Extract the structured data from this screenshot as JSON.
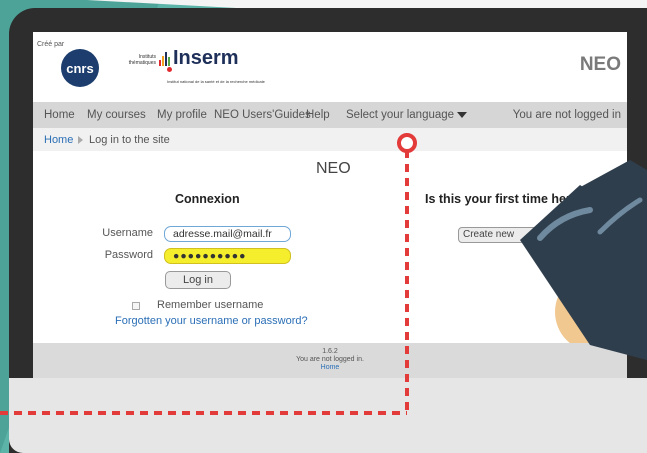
{
  "header": {
    "created_by": "Créé par",
    "cnrs_logo": "cnrs",
    "instituts_text": "Instituts thématiques",
    "inserm_logo": "Inserm",
    "inserm_subtitle": "Institut national de la santé et de la recherche médicale",
    "site_name": "NEO"
  },
  "nav": {
    "items": [
      "Home",
      "My courses",
      "My profile",
      "NEO Users'Guides",
      "Help",
      "Select your language"
    ],
    "login_status": "You are not logged in"
  },
  "breadcrumb": {
    "home": "Home",
    "current": "Log in to the site"
  },
  "main": {
    "title": "NEO",
    "login": {
      "heading": "Connexion",
      "username_label": "Username",
      "username_value": "adresse.mail@mail.fr",
      "password_label": "Password",
      "password_value": "●●●●●●●●●●",
      "login_button": "Log in",
      "remember_label": "Remember username",
      "forgot_link": "Forgotten your username or password?"
    },
    "signup": {
      "heading": "Is this your first time here",
      "create_button": "Create new"
    }
  },
  "footer": {
    "version": "1.6.2",
    "status": "You are not logged in.",
    "home_link": "Home"
  },
  "colors": {
    "background_teal": "#5cb3a8",
    "monitor_frame": "#2d2d2d",
    "link_blue": "#2b6fb6",
    "highlight_yellow": "#f4ee2c",
    "marker_red": "#e33a3a"
  }
}
